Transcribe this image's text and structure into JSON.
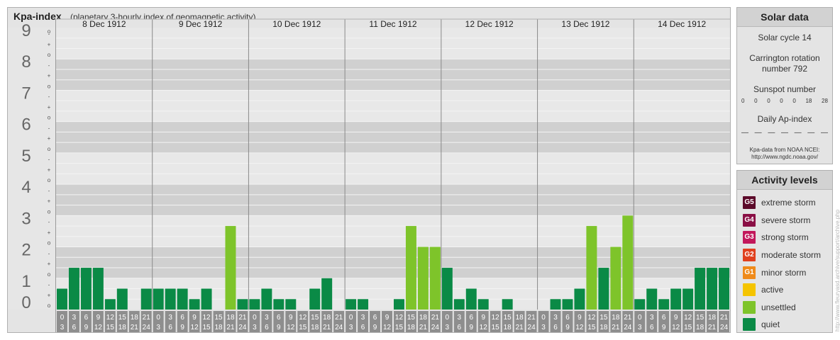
{
  "header": {
    "title": "Kpa-index",
    "subtitle": "(planetary 3-hourly index of geomagnetic activity)"
  },
  "chart_data": {
    "type": "bar",
    "ylim": [
      0,
      9
    ],
    "y_major_ticks": [
      "0",
      "1",
      "2",
      "3",
      "4",
      "5",
      "6",
      "7",
      "8",
      "9"
    ],
    "y_minor_ticks": [
      "o",
      "+",
      "-"
    ],
    "days": [
      "8 Dec 1912",
      "9 Dec 1912",
      "10 Dec 1912",
      "11 Dec 1912",
      "12 Dec 1912",
      "13 Dec 1912",
      "14 Dec 1912"
    ],
    "interval_starts": [
      "0",
      "3",
      "6",
      "9",
      "12",
      "15",
      "18",
      "21"
    ],
    "interval_ends": [
      "3",
      "6",
      "9",
      "12",
      "15",
      "18",
      "21",
      "24"
    ],
    "values": [
      [
        0.667,
        1.333,
        1.333,
        1.333,
        0.333,
        0.667,
        0,
        0.667
      ],
      [
        0.667,
        0.667,
        0.667,
        0.333,
        0.667,
        0,
        2.667,
        0.333
      ],
      [
        0.333,
        0.667,
        0.333,
        0.333,
        0,
        0.667,
        1,
        0
      ],
      [
        0.333,
        0.333,
        0,
        0,
        0.333,
        2.667,
        2,
        2
      ],
      [
        1.333,
        0.333,
        0.667,
        0.333,
        0,
        0.333,
        0,
        0
      ],
      [
        0,
        0.333,
        0.333,
        0.667,
        2.667,
        1.333,
        2,
        3
      ],
      [
        0.333,
        0.667,
        0.333,
        0.667,
        0.667,
        1.333,
        1.333,
        1.333
      ]
    ],
    "level_colors": {
      "quiet": "#0a8a46",
      "unsettled": "#7ec42a"
    }
  },
  "solar": {
    "title": "Solar data",
    "cycle": "Solar cycle 14",
    "carrington_line1": "Carrington rotation",
    "carrington_line2": "number 792",
    "sunspot_label": "Sunspot number",
    "sunspot_values": [
      "0",
      "0",
      "0",
      "0",
      "0",
      "18",
      "28"
    ],
    "ap_label": "Daily Ap-index",
    "ap_values": [
      "—",
      "—",
      "—",
      "—",
      "—",
      "—",
      "—"
    ],
    "source_line1": "Kpa-data from NOAA NCEI:",
    "source_line2": "http://www.ngdc.noaa.gov/"
  },
  "activity": {
    "title": "Activity levels",
    "levels": [
      {
        "badge": "G5",
        "label": "extreme storm",
        "color": "#5c0a2a"
      },
      {
        "badge": "G4",
        "label": "severe storm",
        "color": "#8a0f45"
      },
      {
        "badge": "G3",
        "label": "strong storm",
        "color": "#c2185b"
      },
      {
        "badge": "G2",
        "label": "moderate storm",
        "color": "#e0401e"
      },
      {
        "badge": "G1",
        "label": "minor storm",
        "color": "#ef8a1a"
      },
      {
        "badge": "",
        "label": "active",
        "color": "#f5c400"
      },
      {
        "badge": "",
        "label": "unsettled",
        "color": "#7ec42a"
      },
      {
        "badge": "",
        "label": "quiet",
        "color": "#0a8a46"
      }
    ]
  },
  "credit": "http://www.fleuryasd.archive/support/archive.php"
}
